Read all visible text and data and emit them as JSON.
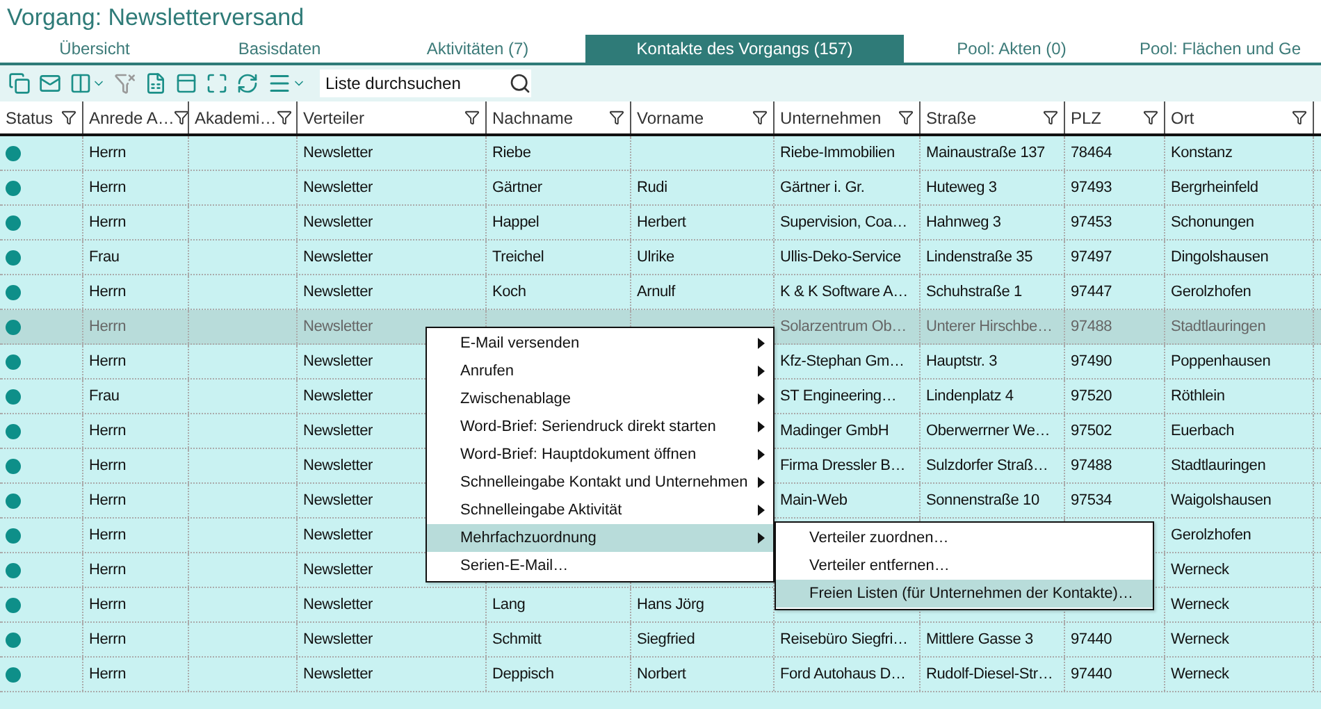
{
  "title": "Vorgang: Newsletterversand",
  "tabs": [
    {
      "label": "Übersicht",
      "selected": false
    },
    {
      "label": "Basisdaten",
      "selected": false
    },
    {
      "label": "Aktivitäten (7)",
      "selected": false
    },
    {
      "label": "Kontakte des Vorgangs (157)",
      "selected": true
    },
    {
      "label": "Pool: Akten (0)",
      "selected": false
    },
    {
      "label": "Pool: Flächen und Ge",
      "selected": false
    }
  ],
  "search": {
    "placeholder": "Liste durchsuchen"
  },
  "columns": [
    {
      "label": "Status"
    },
    {
      "label": "Anrede A…"
    },
    {
      "label": "Akademi…"
    },
    {
      "label": "Verteiler"
    },
    {
      "label": "Nachname"
    },
    {
      "label": "Vorname"
    },
    {
      "label": "Unternehmen"
    },
    {
      "label": "Straße"
    },
    {
      "label": "PLZ"
    },
    {
      "label": "Ort"
    }
  ],
  "rows": [
    {
      "selected": false,
      "anrede": "Herrn",
      "verteiler": "Newsletter",
      "nachname": "Riebe",
      "unternehmen": "Riebe-Immobilien",
      "strasse": "Mainaustraße 137",
      "plz": "78464",
      "ort": "Konstanz"
    },
    {
      "selected": false,
      "anrede": "Herrn",
      "verteiler": "Newsletter",
      "nachname": "Gärtner",
      "vorname": "Rudi",
      "unternehmen": "Gärtner i. Gr.",
      "strasse": "Huteweg 3",
      "plz": "97493",
      "ort": "Bergrheinfeld"
    },
    {
      "selected": false,
      "anrede": "Herrn",
      "verteiler": "Newsletter",
      "nachname": "Happel",
      "vorname": "Herbert",
      "unternehmen": "Supervision, Coa…",
      "strasse": "Hahnweg 3",
      "plz": "97453",
      "ort": "Schonungen"
    },
    {
      "selected": false,
      "anrede": "Frau",
      "verteiler": "Newsletter",
      "nachname": "Treichel",
      "vorname": "Ulrike",
      "unternehmen": "Ullis-Deko-Service",
      "strasse": "Lindenstraße 35",
      "plz": "97497",
      "ort": "Dingolshausen"
    },
    {
      "selected": false,
      "anrede": "Herrn",
      "verteiler": "Newsletter",
      "nachname": "Koch",
      "vorname": "Arnulf",
      "unternehmen": "K & K Software A…",
      "strasse": "Schuhstraße 1",
      "plz": "97447",
      "ort": "Gerolzhofen"
    },
    {
      "selected": true,
      "anrede": "Herrn",
      "verteiler": "Newsletter",
      "unternehmen": "Solarzentrum Ob…",
      "strasse": "Unterer Hirschbe…",
      "plz": "97488",
      "ort": "Stadtlauringen"
    },
    {
      "selected": false,
      "anrede": "Herrn",
      "verteiler": "Newsletter",
      "unternehmen": "Kfz-Stephan Gm…",
      "strasse": "Hauptstr. 3",
      "plz": "97490",
      "ort": "Poppenhausen"
    },
    {
      "selected": false,
      "anrede": "Frau",
      "verteiler": "Newsletter",
      "unternehmen": "ST Engineering…",
      "strasse": "Lindenplatz 4",
      "plz": "97520",
      "ort": "Röthlein"
    },
    {
      "selected": false,
      "anrede": "Herrn",
      "verteiler": "Newsletter",
      "unternehmen": "Madinger GmbH",
      "strasse": "Oberwerrner We…",
      "plz": "97502",
      "ort": "Euerbach"
    },
    {
      "selected": false,
      "anrede": "Herrn",
      "verteiler": "Newsletter",
      "unternehmen": "Firma Dressler B…",
      "strasse": "Sulzdorfer Straß…",
      "plz": "97488",
      "ort": "Stadtlauringen"
    },
    {
      "selected": false,
      "anrede": "Herrn",
      "verteiler": "Newsletter",
      "unternehmen": "Main-Web",
      "strasse": "Sonnenstraße 10",
      "plz": "97534",
      "ort": "Waigolshausen"
    },
    {
      "selected": false,
      "anrede": "Herrn",
      "verteiler": "Newsletter",
      "ort": "Gerolzhofen"
    },
    {
      "selected": false,
      "anrede": "Herrn",
      "verteiler": "Newsletter",
      "ort": "Werneck"
    },
    {
      "selected": false,
      "anrede": "Herrn",
      "verteiler": "Newsletter",
      "nachname": "Lang",
      "vorname": "Hans Jörg",
      "ort": "Werneck"
    },
    {
      "selected": false,
      "anrede": "Herrn",
      "verteiler": "Newsletter",
      "nachname": "Schmitt",
      "vorname": "Siegfried",
      "unternehmen": "Reisebüro Siegfri…",
      "strasse": "Mittlere Gasse 3",
      "plz": "97440",
      "ort": "Werneck"
    },
    {
      "selected": false,
      "anrede": "Herrn",
      "verteiler": "Newsletter",
      "nachname": "Deppisch",
      "vorname": "Norbert",
      "unternehmen": "Ford Autohaus D…",
      "strasse": "Rudolf-Diesel-Str…",
      "plz": "97440",
      "ort": "Werneck"
    }
  ],
  "context_menu": {
    "items": [
      {
        "label": "E-Mail versenden",
        "submenu": true,
        "selected": false
      },
      {
        "label": "Anrufen",
        "submenu": true,
        "selected": false
      },
      {
        "label": "Zwischenablage",
        "submenu": true,
        "selected": false
      },
      {
        "label": "Word-Brief: Seriendruck direkt starten",
        "submenu": true,
        "selected": false
      },
      {
        "label": "Word-Brief: Hauptdokument öffnen",
        "submenu": true,
        "selected": false
      },
      {
        "label": "Schnelleingabe Kontakt und Unternehmen",
        "submenu": true,
        "selected": false
      },
      {
        "label": "Schnelleingabe Aktivität",
        "submenu": true,
        "selected": false
      },
      {
        "label": "Mehrfachzuordnung",
        "submenu": true,
        "selected": true
      },
      {
        "label": "Serien-E-Mail…",
        "submenu": false,
        "selected": false
      }
    ]
  },
  "submenu": {
    "items": [
      {
        "label": "Verteiler zuordnen…",
        "selected": false
      },
      {
        "label": "Verteiler entfernen…",
        "selected": false
      },
      {
        "label": "Freien Listen (für Unternehmen der Kontakte)…",
        "selected": true
      }
    ]
  }
}
